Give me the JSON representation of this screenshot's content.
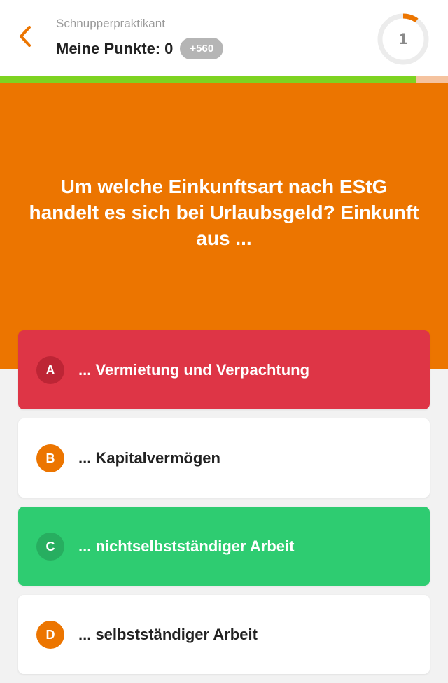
{
  "header": {
    "level_title": "Schnupperpraktikant",
    "score_label": "Meine Punkte:",
    "score_value": "0",
    "bonus": "+560",
    "question_number": "1",
    "timer_progress": 0.1,
    "back_icon": "chevron-left-icon"
  },
  "progress": {
    "fraction": 0.93,
    "fill_color": "#7ed321",
    "track_color": "#f5c39f"
  },
  "question": {
    "text": "Um welche Einkunftsart nach EStG handelt es sich bei Urlaubsgeld? Einkunft aus ..."
  },
  "answers": [
    {
      "letter": "A",
      "text": "... Vermietung und Verpachtung",
      "state": "wrong",
      "bg": "#de3546",
      "text_color": "#ffffff",
      "badge_bg": "#bd2535"
    },
    {
      "letter": "B",
      "text": "... Kapitalvermögen",
      "state": "neutral",
      "bg": "#ffffff",
      "text_color": "#222222",
      "badge_bg": "#ec7500"
    },
    {
      "letter": "C",
      "text": "... nichtselbstständiger Arbeit",
      "state": "correct",
      "bg": "#2ecc71",
      "text_color": "#ffffff",
      "badge_bg": "#27ae60"
    },
    {
      "letter": "D",
      "text": "... selbstständiger Arbeit",
      "state": "neutral",
      "bg": "#ffffff",
      "text_color": "#222222",
      "badge_bg": "#ec7500"
    }
  ],
  "colors": {
    "accent": "#ec7500",
    "correct": "#2ecc71",
    "wrong": "#de3546"
  }
}
